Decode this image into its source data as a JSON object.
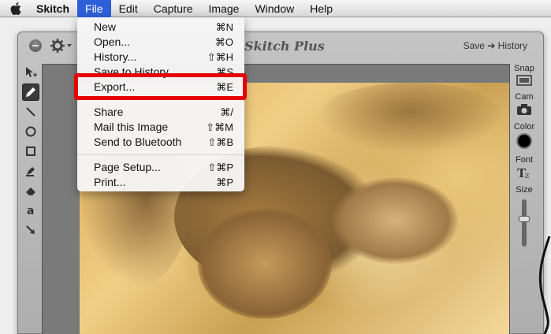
{
  "menubar": {
    "app": "Skitch",
    "items": [
      "File",
      "Edit",
      "Capture",
      "Image",
      "Window",
      "Help"
    ]
  },
  "window": {
    "title": "Skitch Plus",
    "save_history": "Save ➔ History"
  },
  "right_panel": {
    "snap": "Snap",
    "cam": "Cam",
    "color": "Color",
    "font": "Font",
    "size": "Size",
    "color_value": "#000000",
    "size_level": 0.6
  },
  "file_menu": {
    "items": [
      {
        "label": "New",
        "shortcut": "⌘N"
      },
      {
        "label": "Open...",
        "shortcut": "⌘O"
      },
      {
        "label": "History...",
        "shortcut": "⇧⌘H"
      },
      {
        "label": "Save to History",
        "shortcut": "⌘S"
      },
      {
        "label": "Export...",
        "shortcut": "⌘E"
      },
      {
        "label": "Share",
        "shortcut": "⌘/"
      },
      {
        "label": "Mail this Image",
        "shortcut": "⇧⌘M"
      },
      {
        "label": "Send to Bluetooth",
        "shortcut": "⇧⌘B"
      },
      {
        "label": "Page Setup...",
        "shortcut": "⇧⌘P"
      },
      {
        "label": "Print...",
        "shortcut": "⌘P"
      }
    ]
  },
  "colors": {
    "menu_highlight": "#2d5fd9",
    "annotation_red": "#e50000"
  }
}
